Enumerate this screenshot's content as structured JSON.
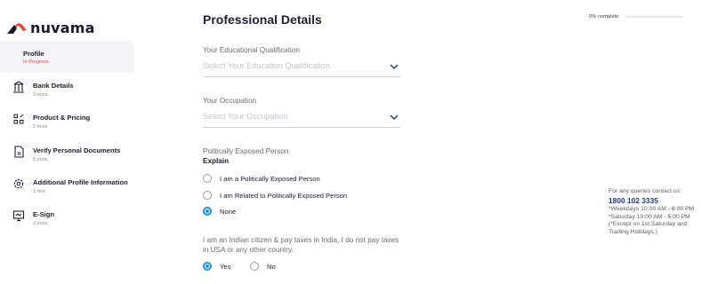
{
  "brand": {
    "name": "nuvama",
    "accent": "#e04a3c",
    "primary": "#1f8fd8"
  },
  "sidebar": {
    "items": [
      {
        "label": "Profile",
        "sub": "In Progress",
        "icon": "none",
        "active": true
      },
      {
        "label": "Bank Details",
        "sub": "3 mins",
        "icon": "bank-icon"
      },
      {
        "label": "Product & Pricing",
        "sub": "2 mins",
        "icon": "grid-icon"
      },
      {
        "label": "Verify Personal Documents",
        "sub": "5 mins",
        "icon": "document-icon"
      },
      {
        "label": "Additional Profile Information",
        "sub": "1 min",
        "icon": "gear-icon"
      },
      {
        "label": "E-Sign",
        "sub": "3 mins",
        "icon": "monitor-icon"
      }
    ]
  },
  "main": {
    "title": "Professional Details",
    "education": {
      "label": "Your Educational Qualification",
      "placeholder": "Select Your Education Qualification"
    },
    "occupation": {
      "label": "Your Occupation",
      "placeholder": "Select Your Occupation"
    },
    "pep": {
      "label": "Politically Exposed Person",
      "explain": "Explain",
      "options": [
        {
          "label": "I am a Politically Exposed Person",
          "selected": false
        },
        {
          "label": "I am Related to Politically Exposed Person",
          "selected": false
        },
        {
          "label": "None",
          "selected": true
        }
      ]
    },
    "citizen": {
      "text": "I am an Indian citizen & pay taxes in India, I do not pay taxes in USA or any other country.",
      "options": [
        {
          "label": "Yes",
          "selected": true
        },
        {
          "label": "No",
          "selected": false
        }
      ]
    }
  },
  "progress": {
    "text": "0% complete",
    "value": 0
  },
  "contact": {
    "heading": "For any queries contact us:",
    "phone": "1800 102 3335",
    "weekdays": "*Weekdays 10:00 AM - 6:00 PM",
    "saturday": "*Saturday 10:00 AM - 5:00 PM",
    "note": "(*Except on 1st Saturday and Trading Holidays.)"
  }
}
